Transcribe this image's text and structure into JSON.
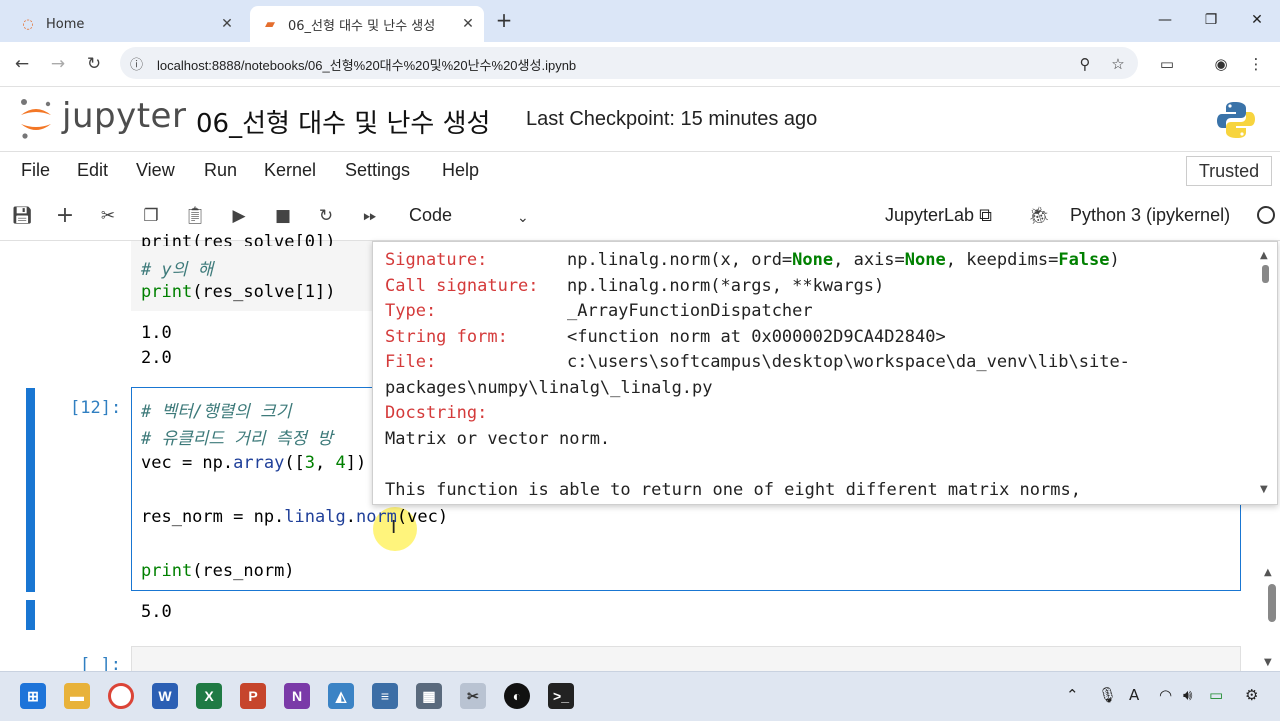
{
  "browser": {
    "tabs": [
      {
        "label": "Home"
      },
      {
        "label": "06_선형 대수 및 난수 생성"
      }
    ],
    "url": "localhost:8888/notebooks/06_선형%20대수%20및%20난수%20생성.ipynb"
  },
  "header": {
    "logo_text": "jupyter",
    "notebook_title": "06_선형 대수 및 난수 생성",
    "checkpoint": "Last Checkpoint: 15 minutes ago"
  },
  "menu": [
    "File",
    "Edit",
    "View",
    "Run",
    "Kernel",
    "Settings",
    "Help"
  ],
  "trusted": "Trusted",
  "toolbar": {
    "cell_type": "Code",
    "jupyterlab": "JupyterLab",
    "kernel": "Python 3 (ipykernel)"
  },
  "cells": {
    "prev": {
      "line_top": "print(res_solve[0])",
      "comment": "# y의 해",
      "print_fn": "print",
      "print_arg": "(res_solve[1])",
      "output": [
        "1.0",
        "2.0"
      ]
    },
    "current": {
      "prompt": "[12]:",
      "comment1": "# 벡터/행렬의 크기",
      "comment2": "# 유클리드 거리 측정 방",
      "line3a": "vec = np.",
      "line3b": "array",
      "line3c": "([",
      "line3d": "3",
      "line3e": ", ",
      "line3f": "4",
      "line3g": "])",
      "line4a": "res_norm = np.",
      "line4b": "linalg",
      "line4c": ".",
      "line4d": "norm",
      "line4e": "(vec)",
      "line5a": "print",
      "line5b": "(res_norm)",
      "output": "5.0"
    },
    "next": {
      "prompt": "[ ]:"
    }
  },
  "tooltip": {
    "rows": [
      {
        "key": "Signature:",
        "value": "np.linalg.norm(x, ord=None, axis=None, keepdims=False)"
      },
      {
        "key": "Call signature:",
        "value": "np.linalg.norm(*args, **kwargs)"
      },
      {
        "key": "Type:",
        "value": "_ArrayFunctionDispatcher"
      },
      {
        "key": "String form:",
        "value": "<function norm at 0x000002D9CA4D2840>"
      },
      {
        "key": "File:",
        "value": "c:\\users\\softcampus\\desktop\\workspace\\da_venv\\lib\\site-"
      }
    ],
    "file_cont": "packages\\numpy\\linalg\\_linalg.py",
    "doc_key": "Docstring:",
    "doc1": "Matrix or vector norm.",
    "doc2": "This function is able to return one of eight different matrix norms,"
  },
  "icons": {
    "home": "home-icon",
    "notebook": "notebook-icon",
    "python": "python-logo"
  }
}
